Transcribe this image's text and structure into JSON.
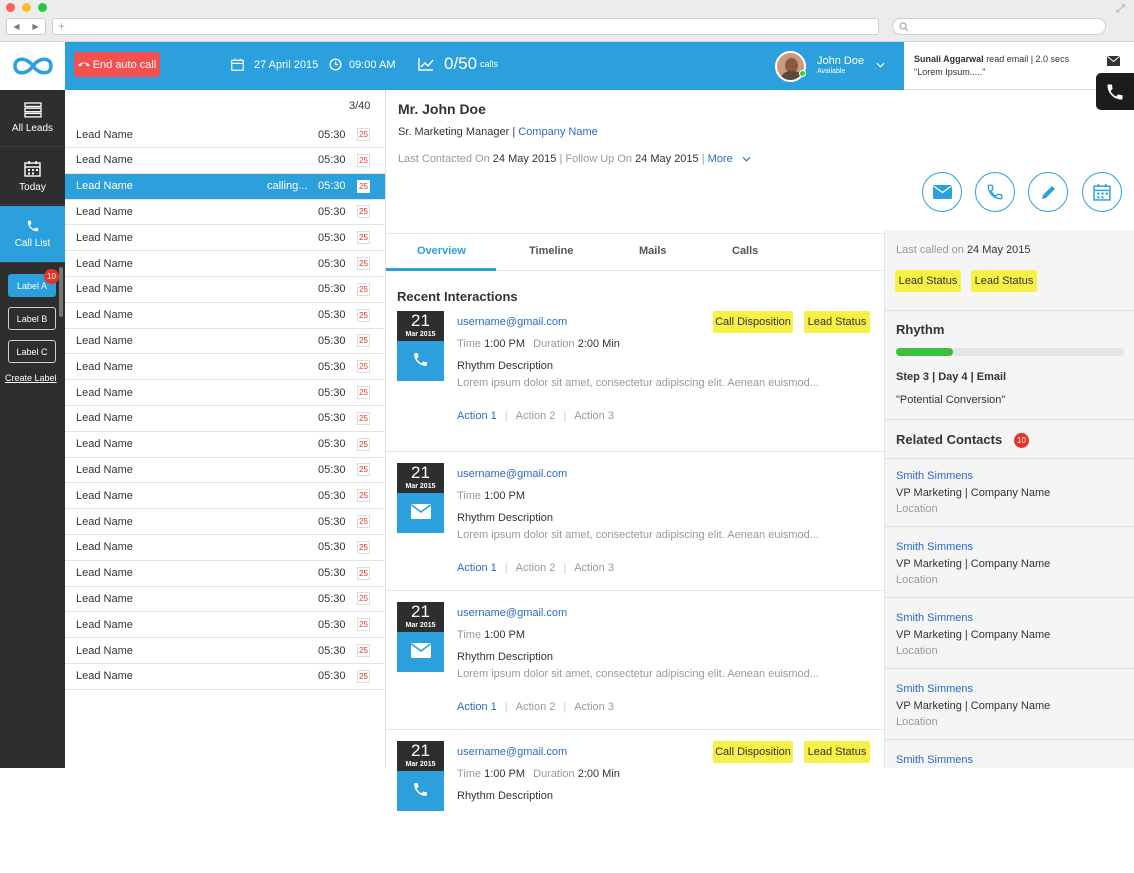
{
  "colors": {
    "accent": "#2ba0dd",
    "sidebar": "#2e2e2e",
    "danger": "#f2514f",
    "highlight": "#f7f046",
    "link": "#2a6bc7"
  },
  "browser": {
    "nav_back": "◀",
    "nav_forward": "▶",
    "new_tab": "+"
  },
  "sidebar": {
    "items": [
      {
        "label": "All Leads",
        "icon": "server-icon"
      },
      {
        "label": "Today",
        "icon": "calendar-icon"
      },
      {
        "label": "Call List",
        "icon": "phone-icon"
      }
    ],
    "labels": [
      {
        "label": "Label A",
        "badge": "10"
      },
      {
        "label": "Label B"
      },
      {
        "label": "Label C"
      }
    ],
    "create_label": "Create Label"
  },
  "topbar": {
    "end_call": "End auto call",
    "date": "27 April 2015",
    "time": "09:00 AM",
    "calls_count": "0/50",
    "calls_suffix": "calls",
    "user_name": "John Doe",
    "user_status": "Available"
  },
  "notification": {
    "title": "Sunali Aggarwal",
    "text": " read email | 2.0 secs",
    "quote": "\"Lorem Ipsum.....\""
  },
  "leads": {
    "counter": "3/40",
    "rows": [
      {
        "name": "Lead Name",
        "time": "05:30",
        "badge": "25"
      },
      {
        "name": "Lead Name",
        "time": "05:30",
        "badge": "25"
      },
      {
        "name": "Lead Name",
        "time": "05:30",
        "badge": "25",
        "status": "calling..."
      },
      {
        "name": "Lead Name",
        "time": "05:30",
        "badge": "25"
      },
      {
        "name": "Lead Name",
        "time": "05:30",
        "badge": "25"
      },
      {
        "name": "Lead Name",
        "time": "05:30",
        "badge": "25"
      },
      {
        "name": "Lead Name",
        "time": "05:30",
        "badge": "25"
      },
      {
        "name": "Lead Name",
        "time": "05:30",
        "badge": "25"
      },
      {
        "name": "Lead Name",
        "time": "05:30",
        "badge": "25"
      },
      {
        "name": "Lead Name",
        "time": "05:30",
        "badge": "25"
      },
      {
        "name": "Lead Name",
        "time": "05:30",
        "badge": "25"
      },
      {
        "name": "Lead Name",
        "time": "05:30",
        "badge": "25"
      },
      {
        "name": "Lead Name",
        "time": "05:30",
        "badge": "25"
      },
      {
        "name": "Lead Name",
        "time": "05:30",
        "badge": "25"
      },
      {
        "name": "Lead Name",
        "time": "05:30",
        "badge": "25"
      },
      {
        "name": "Lead Name",
        "time": "05:30",
        "badge": "25"
      },
      {
        "name": "Lead Name",
        "time": "05:30",
        "badge": "25"
      },
      {
        "name": "Lead Name",
        "time": "05:30",
        "badge": "25"
      },
      {
        "name": "Lead Name",
        "time": "05:30",
        "badge": "25"
      },
      {
        "name": "Lead Name",
        "time": "05:30",
        "badge": "25"
      },
      {
        "name": "Lead Name",
        "time": "05:30",
        "badge": "25"
      },
      {
        "name": "Lead Name",
        "time": "05:30",
        "badge": "25"
      }
    ]
  },
  "contact": {
    "name": "Mr. John Doe",
    "role": "Sr. Marketing Manager | ",
    "company": "Company Name",
    "last_contacted_label": "Last Contacted On ",
    "last_contacted": "24 May 2015",
    "follow_up_label": " | Follow Up On ",
    "follow_up": "24 May 2015",
    "more": "More"
  },
  "tabs": [
    "Overview",
    "Timeline",
    "Mails",
    "Calls"
  ],
  "recent": {
    "title": "Recent Interactions",
    "items": [
      {
        "day": "21",
        "month": "Mar 2015",
        "email": "username@gmail.com",
        "time": "1:00 PM",
        "duration": "2:00 Min",
        "desc": "Rhythm Description",
        "lorem": "Lorem ipsum dolor sit amet, consectetur adipiscing elit. Aenean euismod...",
        "actions": [
          "Action 1",
          "Action 2",
          "Action 3"
        ],
        "tags": [
          "Call Disposition",
          "Lead Status"
        ],
        "icon": "phone-icon"
      },
      {
        "day": "21",
        "month": "Mar 2015",
        "email": "username@gmail.com",
        "time": "1:00 PM",
        "desc": "Rhythm Description",
        "lorem": "Lorem ipsum dolor sit amet, consectetur adipiscing elit. Aenean euismod...",
        "actions": [
          "Action 1",
          "Action 2",
          "Action 3"
        ],
        "icon": "mail-icon"
      },
      {
        "day": "21",
        "month": "Mar 2015",
        "email": "username@gmail.com",
        "time": "1:00 PM",
        "desc": "Rhythm Description",
        "lorem": "Lorem ipsum dolor sit amet, consectetur adipiscing elit. Aenean euismod...",
        "actions": [
          "Action 1",
          "Action 2",
          "Action 3"
        ],
        "icon": "mail-icon"
      },
      {
        "day": "21",
        "month": "Mar 2015",
        "email": "username@gmail.com",
        "time": "1:00 PM",
        "duration": "2:00 Min",
        "desc": "Rhythm Description",
        "tags": [
          "Call Disposition",
          "Lead Status"
        ],
        "icon": "phone-icon"
      }
    ],
    "time_label": "Time ",
    "duration_label": "Duration "
  },
  "right": {
    "last_called_label": "Last called on ",
    "last_called": "24 May 2015",
    "tags": [
      "Lead Status",
      "Lead Status"
    ],
    "rhythm_title": "Rhythm",
    "rhythm_progress": 0.25,
    "step": "Step 3 | Day 4 | Email",
    "conversion": "\"Potential Conversion\"",
    "related_title": "Related Contacts",
    "related_badge": "10",
    "contacts": [
      {
        "name": "Smith Simmens",
        "role": "VP Marketing | Company Name",
        "location": "Location"
      },
      {
        "name": "Smith Simmens",
        "role": "VP Marketing | Company Name",
        "location": "Location"
      },
      {
        "name": "Smith Simmens",
        "role": "VP Marketing | Company Name",
        "location": "Location"
      },
      {
        "name": "Smith Simmens",
        "role": "VP Marketing | Company Name",
        "location": "Location"
      },
      {
        "name": "Smith Simmens"
      }
    ]
  }
}
